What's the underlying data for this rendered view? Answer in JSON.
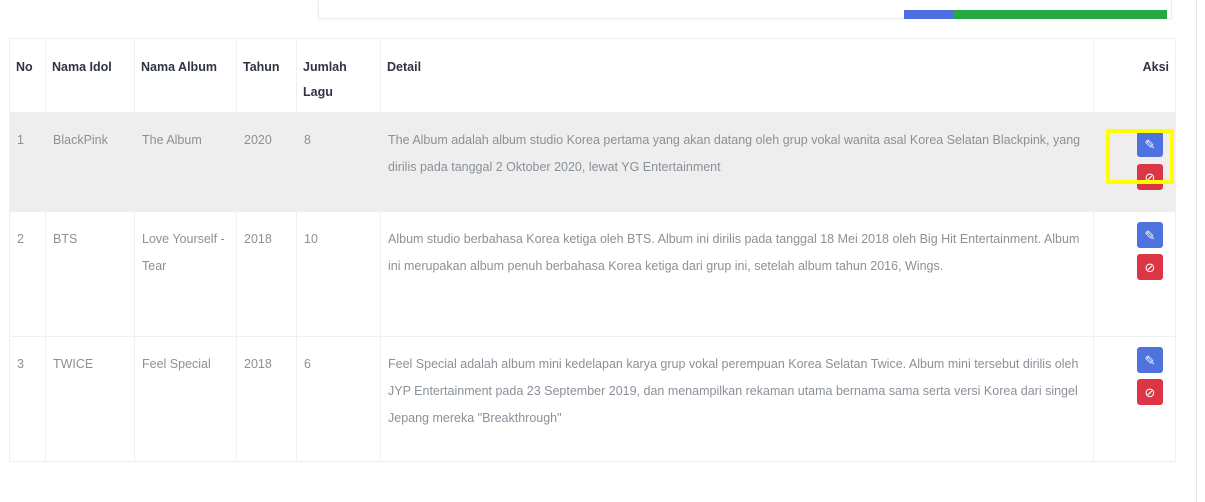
{
  "table": {
    "headers": {
      "no": "No",
      "nama_idol": "Nama Idol",
      "nama_album": "Nama Album",
      "tahun": "Tahun",
      "jumlah_lagu": "Jumlah Lagu",
      "detail": "Detail",
      "aksi": "Aksi"
    },
    "rows": [
      {
        "no": "1",
        "idol": "BlackPink",
        "album": "The Album",
        "tahun": "2020",
        "jumlah_lagu": "8",
        "detail": "The Album adalah album studio Korea pertama yang akan datang oleh grup vokal wanita asal Korea Selatan Blackpink, yang dirilis pada tanggal 2 Oktober 2020, lewat YG Entertainment"
      },
      {
        "no": "2",
        "idol": "BTS",
        "album": "Love Yourself - Tear",
        "tahun": "2018",
        "jumlah_lagu": "10",
        "detail": "Album studio berbahasa Korea ketiga oleh BTS. Album ini dirilis pada tanggal 18 Mei 2018 oleh Big Hit Entertainment. Album ini merupakan album penuh berbahasa Korea ketiga dari grup ini, setelah album tahun 2016, Wings."
      },
      {
        "no": "3",
        "idol": "TWICE",
        "album": "Feel Special",
        "tahun": "2018",
        "jumlah_lagu": "6",
        "detail": "Feel Special adalah album mini kedelapan karya grup vokal perempuan Korea Selatan Twice. Album mini tersebut dirilis oleh JYP Entertainment pada 23 September 2019, dan menampilkan rekaman utama bernama sama serta versi Korea dari singel Jepang mereka \"Breakthrough\""
      }
    ]
  },
  "icons": {
    "edit": "pencil-icon",
    "delete": "ban-icon"
  },
  "colors": {
    "edit_button": "#4e73df",
    "delete_button": "#dc3545",
    "highlight": "#ffff00",
    "top_bar_blue": "#4f6fe0",
    "top_bar_green": "#28a745",
    "row_highlight_bg": "#eeeeee"
  }
}
